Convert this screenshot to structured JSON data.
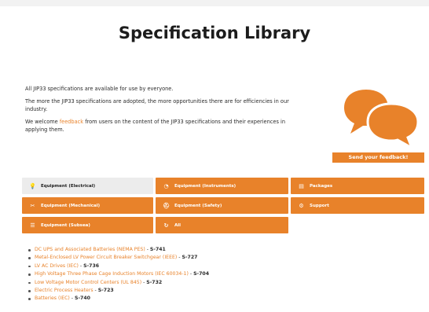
{
  "page": {
    "title": "Specification Library"
  },
  "intro": {
    "p1": "All JIP33 specifications are available for use by everyone.",
    "p2": "The more the JIP33 specifications are adopted, the more opportunities there are for efficiencies in our industry.",
    "p3_before": "We welcome ",
    "p3_link": "feedback",
    "p3_after": " from users on the content of the JIP33 specifications and their experiences in applying them."
  },
  "feedback": {
    "button_label": "Send your feedback!"
  },
  "categories": [
    {
      "label": "Equipment (Electrical)",
      "icon": "lightbulb-icon",
      "active": true
    },
    {
      "label": "Equipment (Instruments)",
      "icon": "gauge-icon",
      "active": false
    },
    {
      "label": "Packages",
      "icon": "package-icon",
      "active": false
    },
    {
      "label": "Equipment (Mechanical)",
      "icon": "wrench-icon",
      "active": false
    },
    {
      "label": "Equipment (Safety)",
      "icon": "helmet-icon",
      "active": false
    },
    {
      "label": "Support",
      "icon": "support-icon",
      "active": false
    },
    {
      "label": "Equipment (Subsea)",
      "icon": "subsea-icon",
      "active": false
    },
    {
      "label": "All",
      "icon": "refresh-icon",
      "active": false
    }
  ],
  "specs": [
    {
      "title": "DC UPS and Associated Batteries (NEMA PES)",
      "code": "S-741"
    },
    {
      "title": "Metal-Enclosed LV Power Circuit Breaker Switchgear (IEEE)",
      "code": "S-727"
    },
    {
      "title": "LV AC Drives (IEC)",
      "code": "S-736"
    },
    {
      "title": "High Voltage Three Phase Cage Induction Motors (IEC 60034-1)",
      "code": "S-704"
    },
    {
      "title": "Low Voltage Motor Control Centers (UL 845)",
      "code": "S-732"
    },
    {
      "title": "Electric Process Heaters",
      "code": "S-723"
    },
    {
      "title": "Batteries (IEC)",
      "code": "S-740"
    }
  ],
  "colors": {
    "accent": "#e8822a",
    "active_bg": "#ececec"
  }
}
